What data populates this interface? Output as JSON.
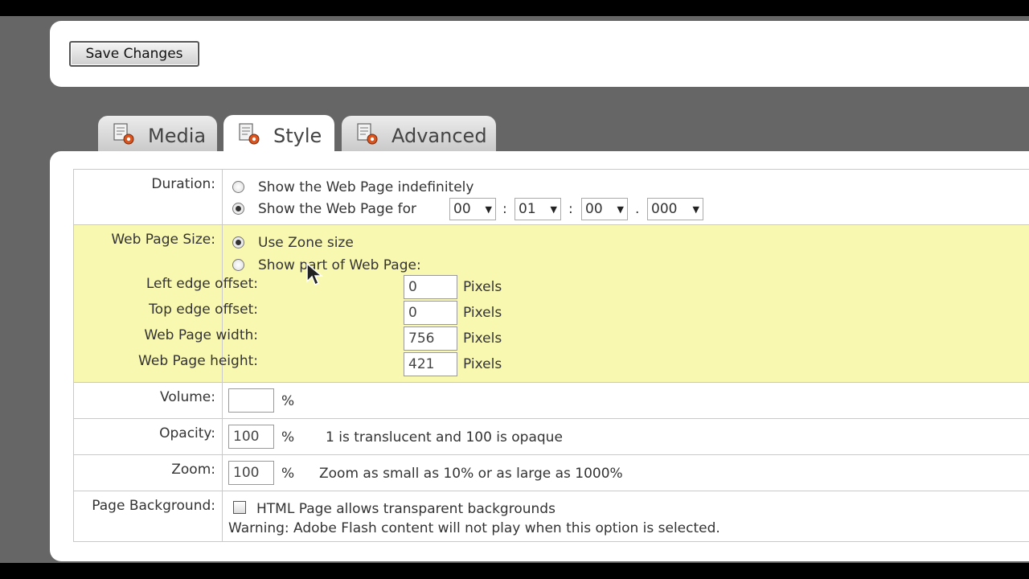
{
  "toolbar": {
    "save_label": "Save Changes"
  },
  "tabs": [
    {
      "label": "Media",
      "icon": "document-gear-icon",
      "active": false
    },
    {
      "label": "Style",
      "icon": "document-gear-icon",
      "active": true
    },
    {
      "label": "Advanced",
      "icon": "document-gear-icon",
      "active": false
    }
  ],
  "duration": {
    "label": "Duration:",
    "option_indefinite": "Show the Web Page indefinitely",
    "option_for": "Show the Web Page for",
    "hours": "00",
    "minutes": "01",
    "seconds": "00",
    "milliseconds": "000",
    "sep_colon": ":",
    "sep_dot": "."
  },
  "web_page_size": {
    "label": "Web Page Size:",
    "option_zone": "Use Zone size",
    "option_part": "Show part of Web Page:",
    "left_label": "Left edge offset:",
    "left_value": "0",
    "top_label": "Top edge offset:",
    "top_value": "0",
    "width_label": "Web Page width:",
    "width_value": "756",
    "height_label": "Web Page height:",
    "height_value": "421",
    "unit": "Pixels"
  },
  "volume": {
    "label": "Volume:",
    "value": "",
    "unit": "%"
  },
  "opacity": {
    "label": "Opacity:",
    "value": "100",
    "unit": "%",
    "hint": "1 is translucent and 100 is opaque"
  },
  "zoom": {
    "label": "Zoom:",
    "value": "100",
    "unit": "%",
    "hint": "Zoom as small as 10% or as large as 1000%"
  },
  "page_background": {
    "label": "Page Background:",
    "checkbox_label": "HTML Page allows transparent backgrounds",
    "warning": "Warning: Adobe Flash content will not play when this option is selected."
  },
  "colors": {
    "page_bg": "#666666",
    "panel_bg": "#ffffff",
    "highlight_row": "#f9f8b0",
    "icon_accent": "#d9541e"
  }
}
